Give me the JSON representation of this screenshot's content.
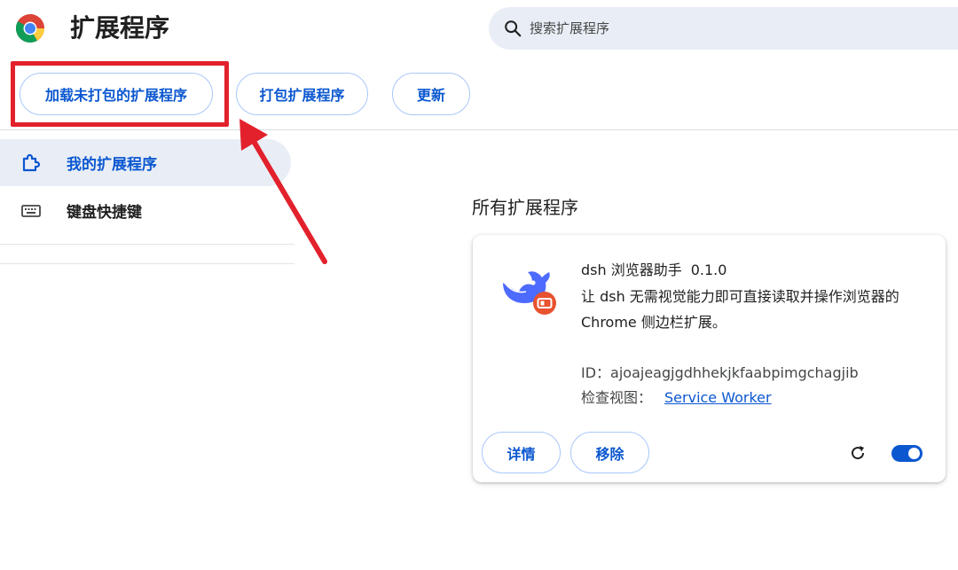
{
  "header": {
    "title": "扩展程序",
    "search_placeholder": "搜索扩展程序"
  },
  "toolbar": {
    "load_unpacked_label": "加载未打包的扩展程序",
    "pack_label": "打包扩展程序",
    "update_label": "更新"
  },
  "sidebar": {
    "items": [
      {
        "label": "我的扩展程序",
        "icon": "puzzle-icon",
        "selected": true
      },
      {
        "label": "键盘快捷键",
        "icon": "keyboard-icon",
        "selected": false
      }
    ]
  },
  "main": {
    "section_title": "所有扩展程序",
    "extension": {
      "name": "dsh 浏览器助手",
      "version": "0.1.0",
      "description": "让 dsh 无需视觉能力即可直接读取并操作浏览器的 Chrome 侧边栏扩展。",
      "id_line": "ID：ajoajeagjgdhhekjkfaabpimgchagjib",
      "inspect_label": "检查视图：",
      "inspect_link": "Service Worker",
      "details_label": "详情",
      "remove_label": "移除",
      "enabled": true
    }
  },
  "colors": {
    "accent": "#0b57d0",
    "pill_border": "#a8c7fa",
    "nav_selected_bg": "#e9eef6",
    "annotation_red": "#e2212c"
  }
}
